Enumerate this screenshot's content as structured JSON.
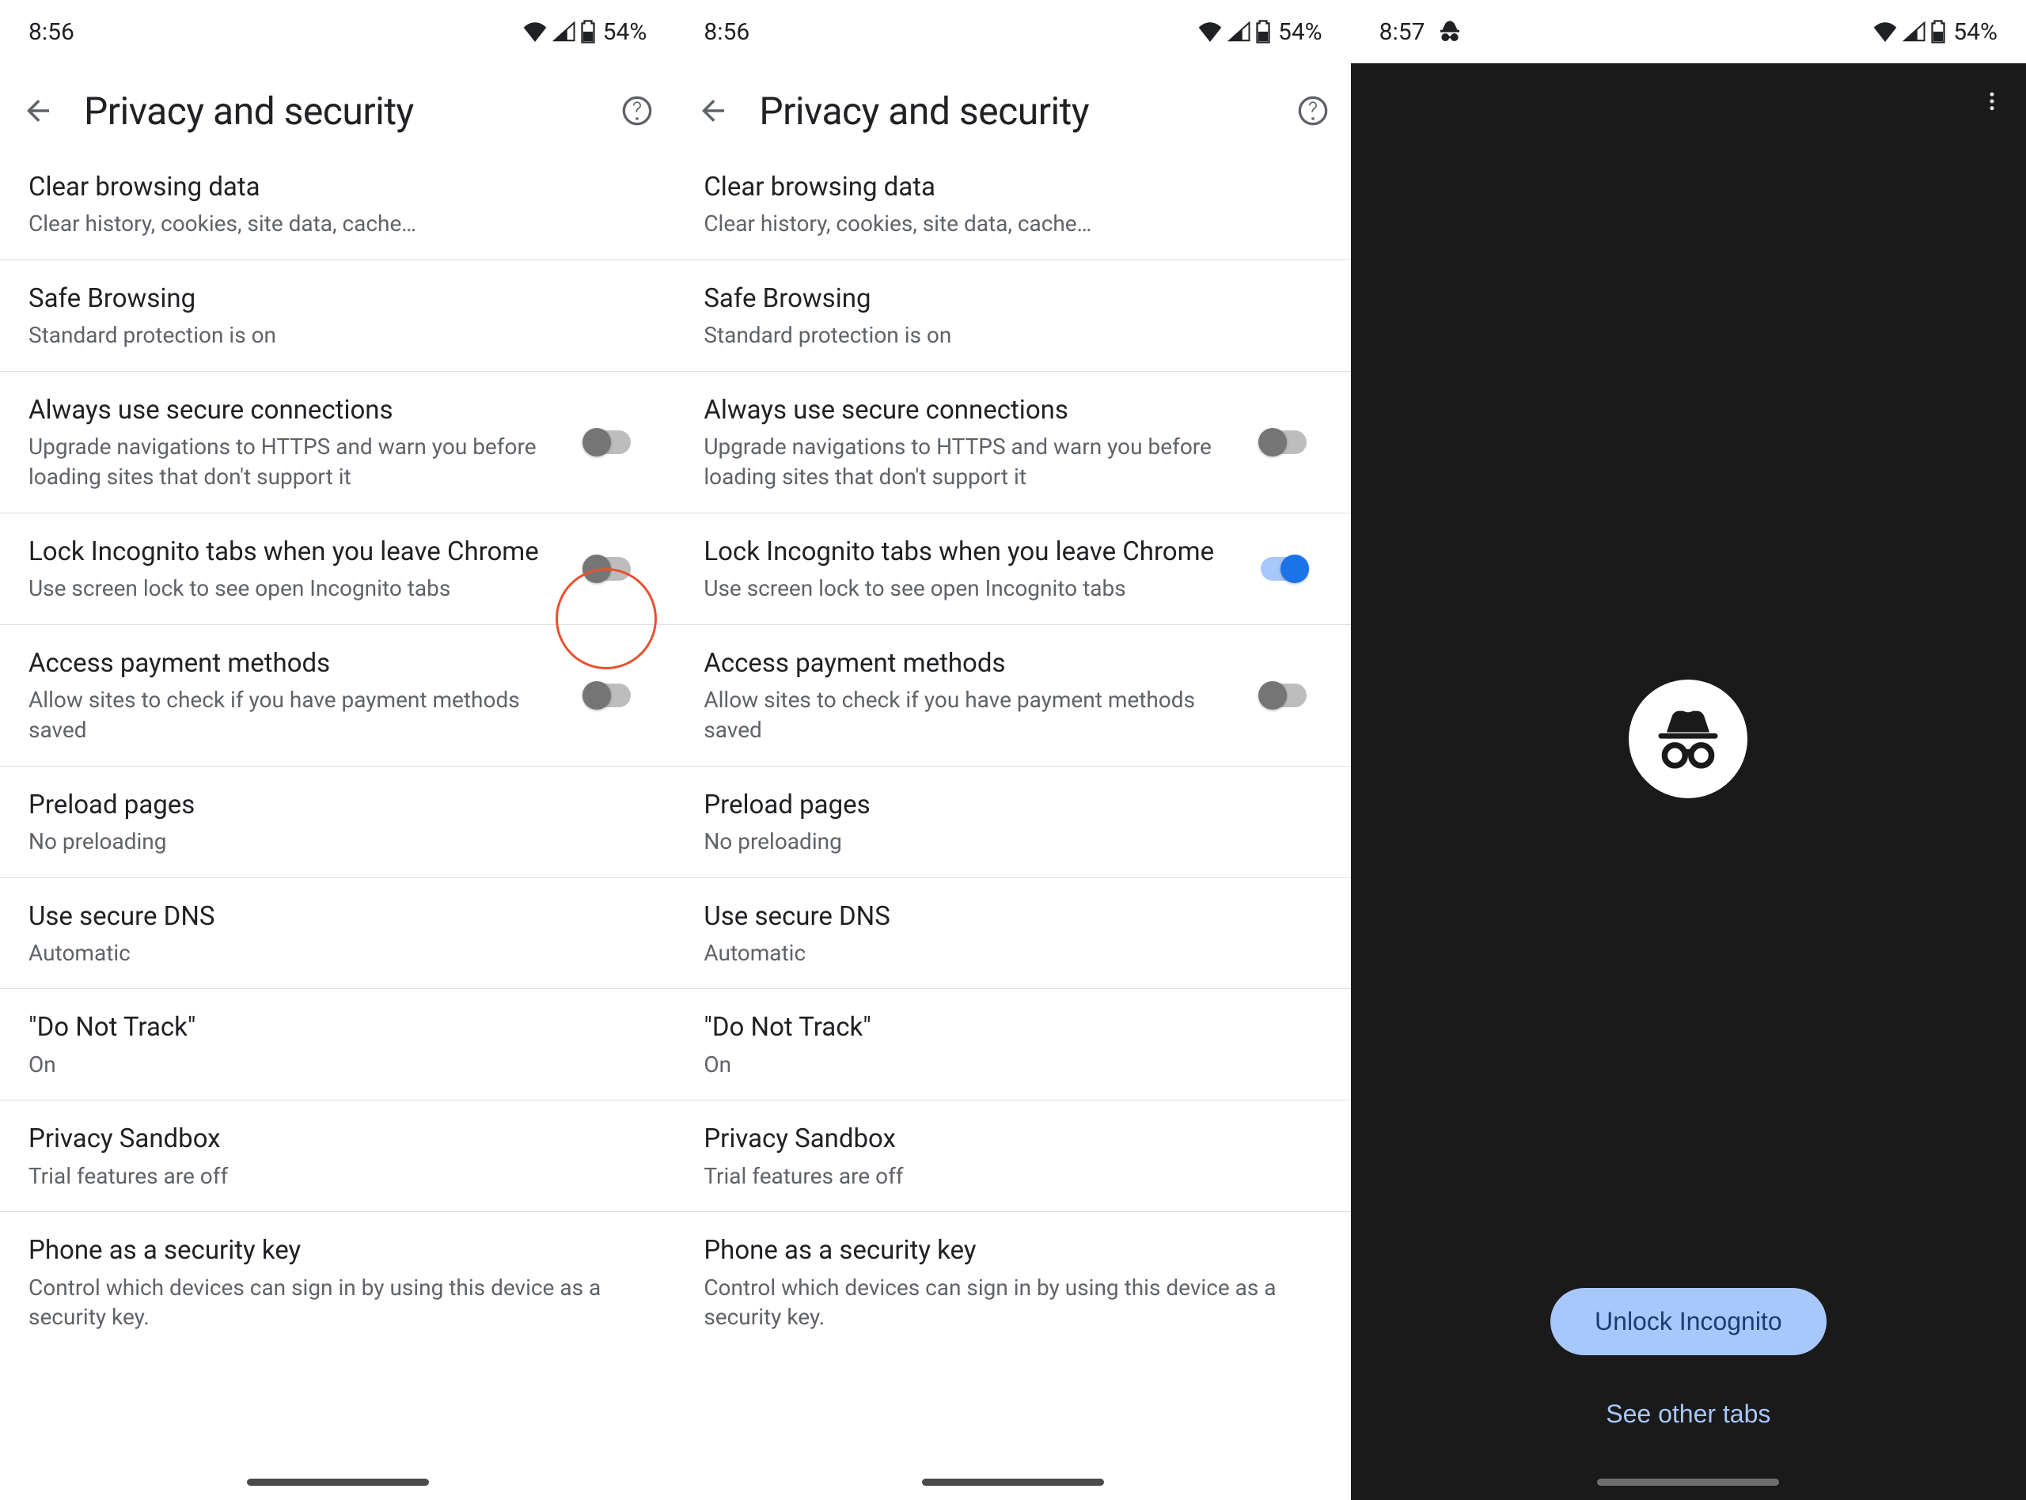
{
  "status": {
    "time_a": "8:56",
    "time_b": "8:56",
    "time_c": "8:57",
    "battery": "54%"
  },
  "header": {
    "title": "Privacy and security"
  },
  "items": [
    {
      "title": "Clear browsing data",
      "sub": "Clear history, cookies, site data, cache…",
      "toggle": null
    },
    {
      "title": "Safe Browsing",
      "sub": "Standard protection is on",
      "toggle": null
    },
    {
      "title": "Always use secure connections",
      "sub": "Upgrade navigations to HTTPS and warn you before loading sites that don't support it",
      "toggle": false
    },
    {
      "title": "Lock Incognito tabs when you leave Chrome",
      "sub": "Use screen lock to see open Incognito tabs",
      "toggle": false
    },
    {
      "title": "Access payment methods",
      "sub": "Allow sites to check if you have payment methods saved",
      "toggle": false
    },
    {
      "title": "Preload pages",
      "sub": "No preloading",
      "toggle": null
    },
    {
      "title": "Use secure DNS",
      "sub": "Automatic",
      "toggle": null
    },
    {
      "title": "\"Do Not Track\"",
      "sub": "On",
      "toggle": null
    },
    {
      "title": "Privacy Sandbox",
      "sub": "Trial features are off",
      "toggle": null
    },
    {
      "title": "Phone as a security key",
      "sub": "Control which devices can sign in by using this device as a security key.",
      "toggle": null
    }
  ],
  "panel_b_overrides": {
    "3": true
  },
  "incognito": {
    "unlock_label": "Unlock Incognito",
    "other_tabs_label": "See other tabs"
  }
}
